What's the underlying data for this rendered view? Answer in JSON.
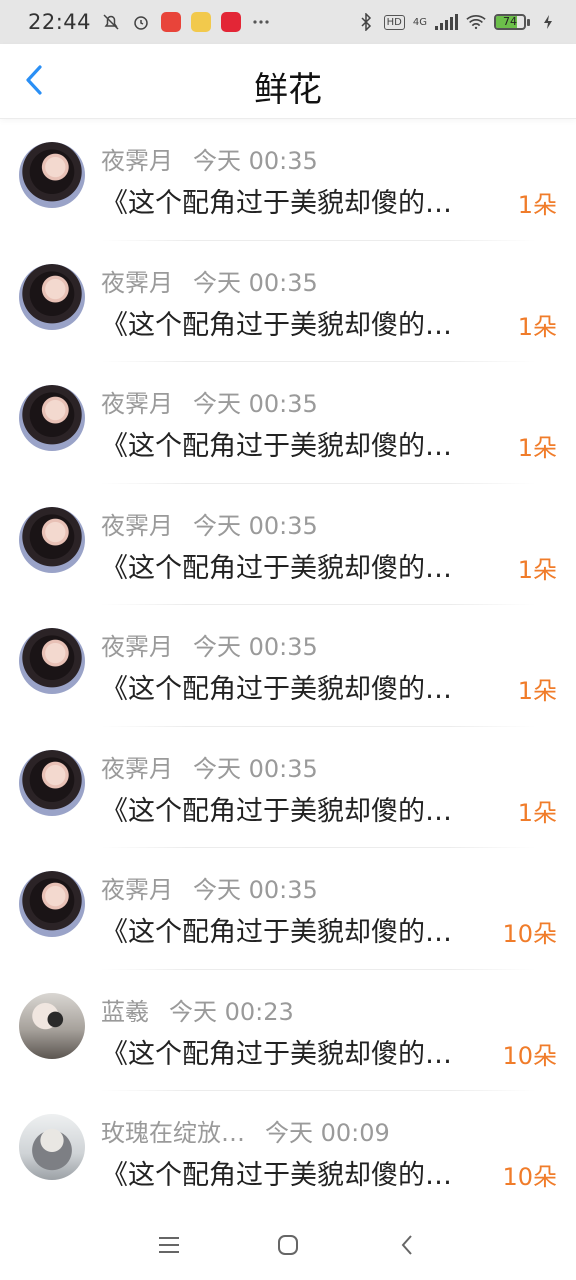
{
  "status_bar": {
    "time": "22:44",
    "network_label": "4G",
    "hd_label": "HD",
    "battery": "74",
    "battery_level": 0.74,
    "icons": [
      "mute-icon",
      "alarm-icon",
      "app-icon",
      "app-icon",
      "app-icon",
      "more-dots-icon",
      "bluetooth-icon",
      "hd-icon",
      "signal-icon",
      "wifi-icon",
      "battery-icon",
      "charging-icon"
    ]
  },
  "header": {
    "title": "鲜花",
    "back_icon": "chevron-left-icon"
  },
  "items": [
    {
      "name": "夜霁月",
      "time": "今天 00:35",
      "title": "《这个配角过于美貌却傻的…",
      "count": "1朵",
      "avatar": "girl-portrait-a"
    },
    {
      "name": "夜霁月",
      "time": "今天 00:35",
      "title": "《这个配角过于美貌却傻的…",
      "count": "1朵",
      "avatar": "girl-portrait-a"
    },
    {
      "name": "夜霁月",
      "time": "今天 00:35",
      "title": "《这个配角过于美貌却傻的…",
      "count": "1朵",
      "avatar": "girl-portrait-a"
    },
    {
      "name": "夜霁月",
      "time": "今天 00:35",
      "title": "《这个配角过于美貌却傻的…",
      "count": "1朵",
      "avatar": "girl-portrait-a"
    },
    {
      "name": "夜霁月",
      "time": "今天 00:35",
      "title": "《这个配角过于美貌却傻的…",
      "count": "1朵",
      "avatar": "girl-portrait-a"
    },
    {
      "name": "夜霁月",
      "time": "今天 00:35",
      "title": "《这个配角过于美貌却傻的…",
      "count": "1朵",
      "avatar": "girl-portrait-a"
    },
    {
      "name": "夜霁月",
      "time": "今天 00:35",
      "title": "《这个配角过于美貌却傻的…",
      "count": "10朵",
      "avatar": "girl-portrait-a"
    },
    {
      "name": "蓝羲",
      "time": "今天 00:23",
      "title": "《这个配角过于美貌却傻的…",
      "count": "10朵",
      "avatar": "selfie-portrait"
    },
    {
      "name": "玫瑰在绽放…",
      "time": "今天 00:09",
      "title": "《这个配角过于美貌却傻的…",
      "count": "10朵",
      "avatar": "ink-painting-portrait"
    }
  ],
  "system_nav": {
    "icons": [
      "menu-icon",
      "home-icon",
      "back-icon"
    ]
  },
  "colors": {
    "accent": "#2a8ff5",
    "count": "#f07c2a",
    "meta": "#9a9a9a",
    "statusbar_bg": "#e6e6e6"
  }
}
